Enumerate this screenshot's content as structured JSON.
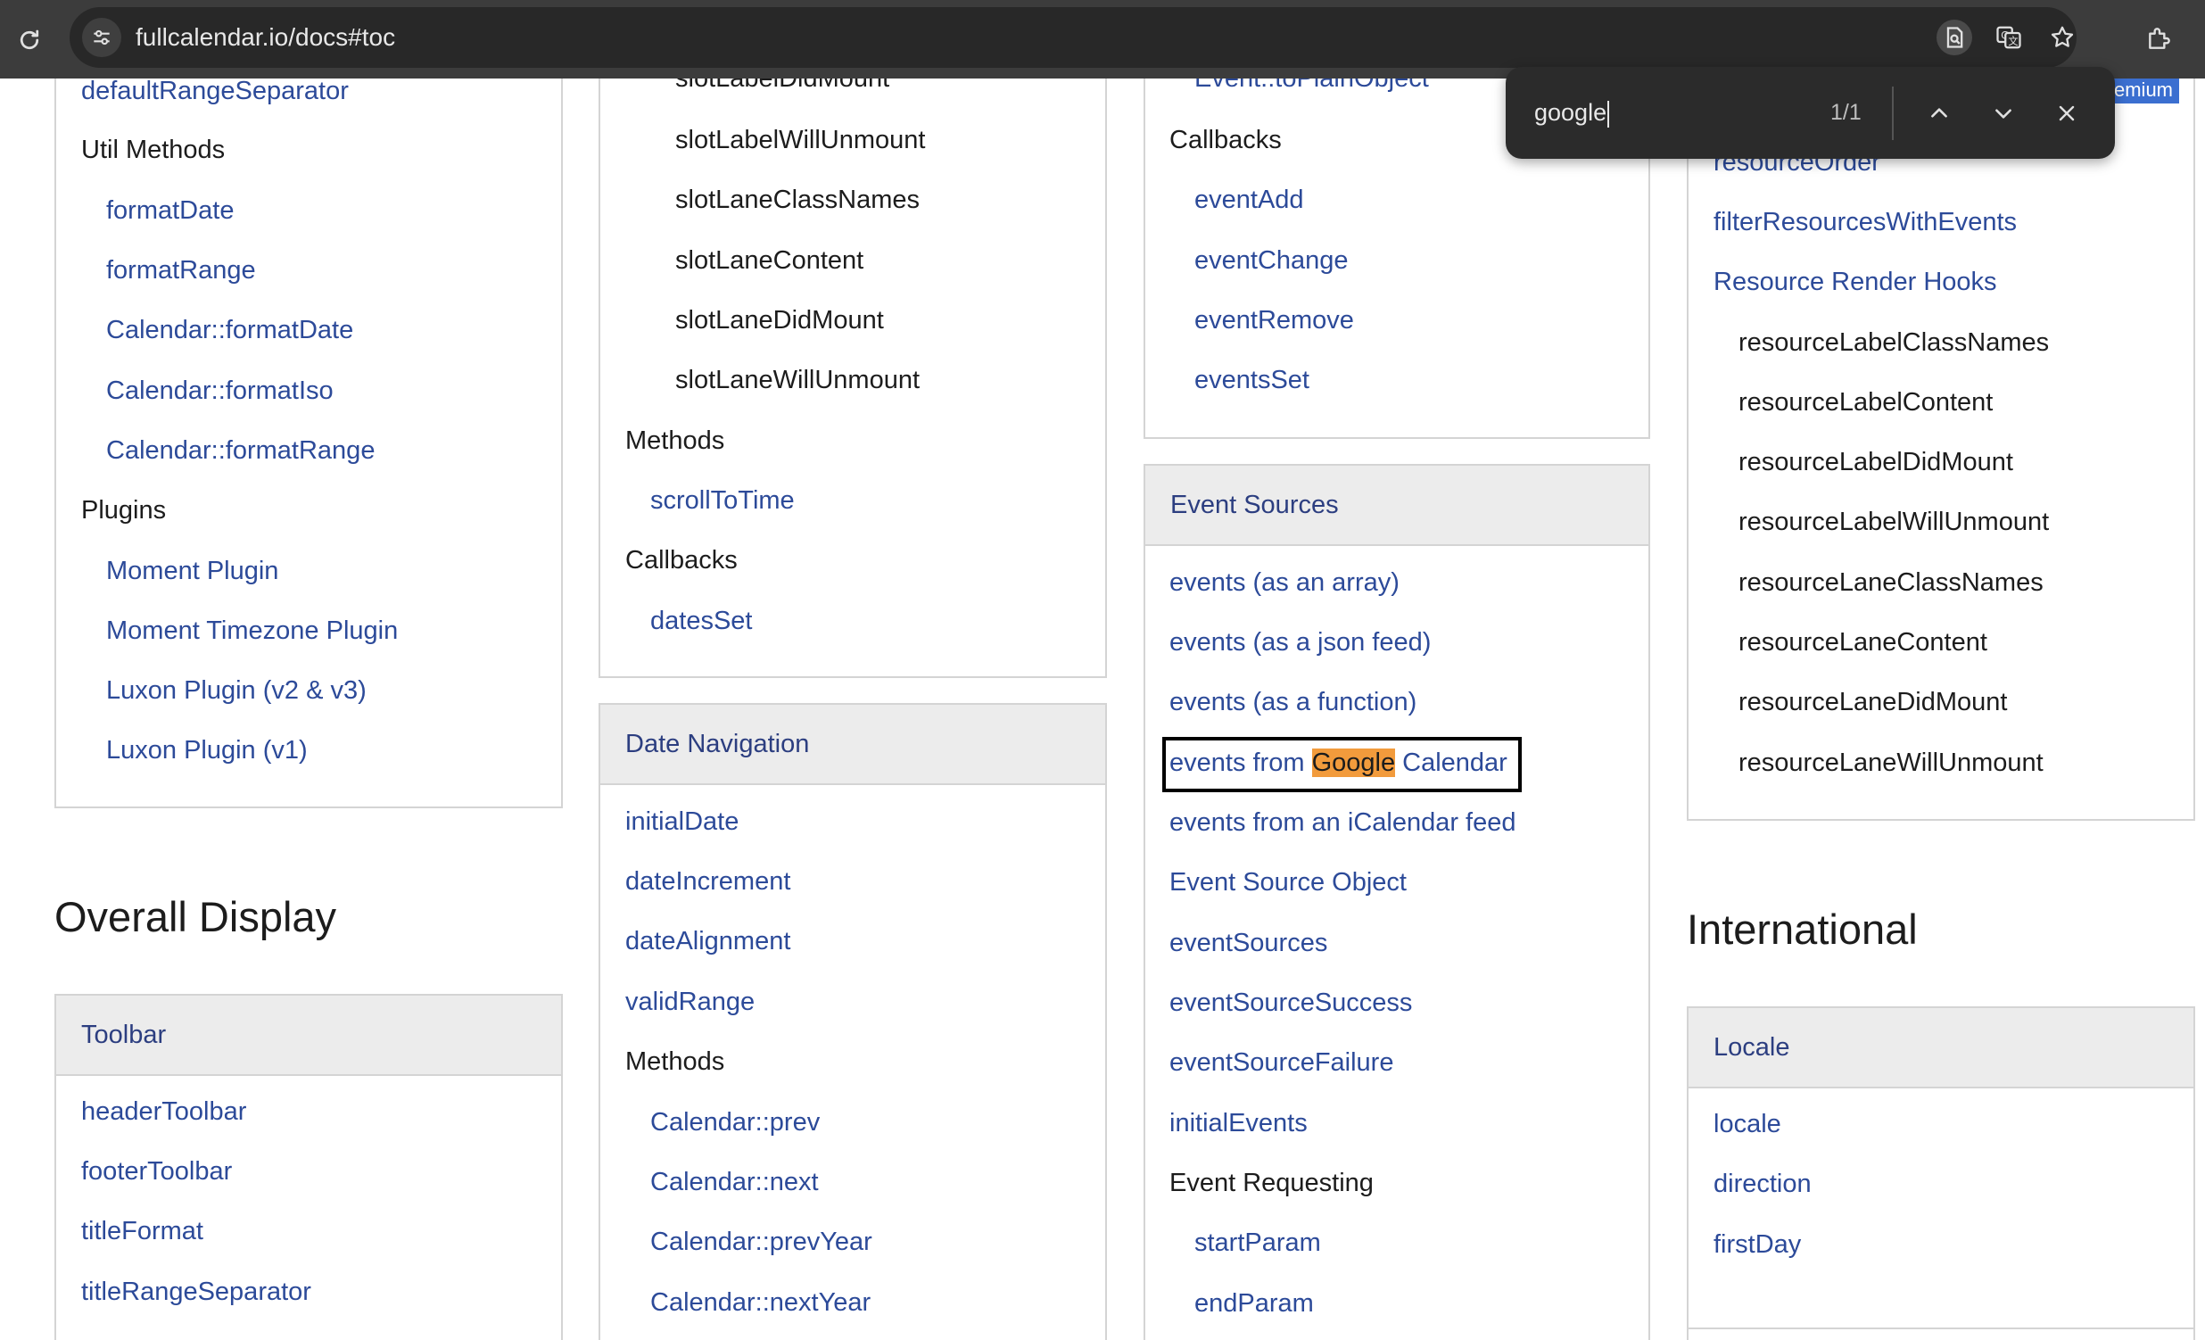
{
  "browser": {
    "url": "fullcalendar.io/docs#toc",
    "icons": [
      "reload-icon",
      "tune-icon",
      "find-in-page-icon",
      "translate-icon",
      "star-icon",
      "extensions-icon"
    ]
  },
  "find_bar": {
    "query": "google",
    "count": "1/1"
  },
  "badge": {
    "premium": "Premium"
  },
  "col1": {
    "items": [
      "defaultRangeSeparator",
      "Util Methods",
      "formatDate",
      "formatRange",
      "Calendar::formatDate",
      "Calendar::formatIso",
      "Calendar::formatRange",
      "Plugins",
      "Moment Plugin",
      "Moment Timezone Plugin",
      "Luxon Plugin (v2 & v3)",
      "Luxon Plugin (v1)"
    ],
    "section_title": "Overall Display",
    "toolbar_card": {
      "title": "Toolbar",
      "items": [
        "headerToolbar",
        "footerToolbar",
        "titleFormat",
        "titleRangeSeparator"
      ]
    }
  },
  "col2": {
    "items": [
      "slotLabelDidMount",
      "slotLabelWillUnmount",
      "slotLaneClassNames",
      "slotLaneContent",
      "slotLaneDidMount",
      "slotLaneWillUnmount",
      "Methods",
      "scrollToTime",
      "Callbacks",
      "datesSet"
    ],
    "date_nav_card": {
      "title": "Date Navigation",
      "items": [
        "initialDate",
        "dateIncrement",
        "dateAlignment",
        "validRange",
        "Methods",
        "Calendar::prev",
        "Calendar::next",
        "Calendar::prevYear",
        "Calendar::nextYear"
      ]
    }
  },
  "col3": {
    "items": [
      "Event::toPlainObject",
      "Callbacks",
      "eventAdd",
      "eventChange",
      "eventRemove",
      "eventsSet"
    ],
    "event_sources_card": {
      "title": "Event Sources",
      "items": [
        "events (as an array)",
        "events (as a json feed)",
        "events (as a function)",
        "events from ",
        "Google",
        " Calendar",
        "events from an iCalendar feed",
        "Event Source Object",
        "eventSources",
        "eventSourceSuccess",
        "eventSourceFailure",
        "initialEvents",
        "Event Requesting",
        "startParam",
        "endParam"
      ]
    }
  },
  "col4": {
    "items": [
      "resourceOrder",
      "filterResourcesWithEvents",
      "Resource Render Hooks",
      "resourceLabelClassNames",
      "resourceLabelContent",
      "resourceLabelDidMount",
      "resourceLabelWillUnmount",
      "resourceLaneClassNames",
      "resourceLaneContent",
      "resourceLaneDidMount",
      "resourceLaneWillUnmount"
    ],
    "section_title": "International",
    "locale_card": {
      "title": "Locale",
      "items": [
        "locale",
        "direction",
        "firstDay"
      ]
    }
  }
}
